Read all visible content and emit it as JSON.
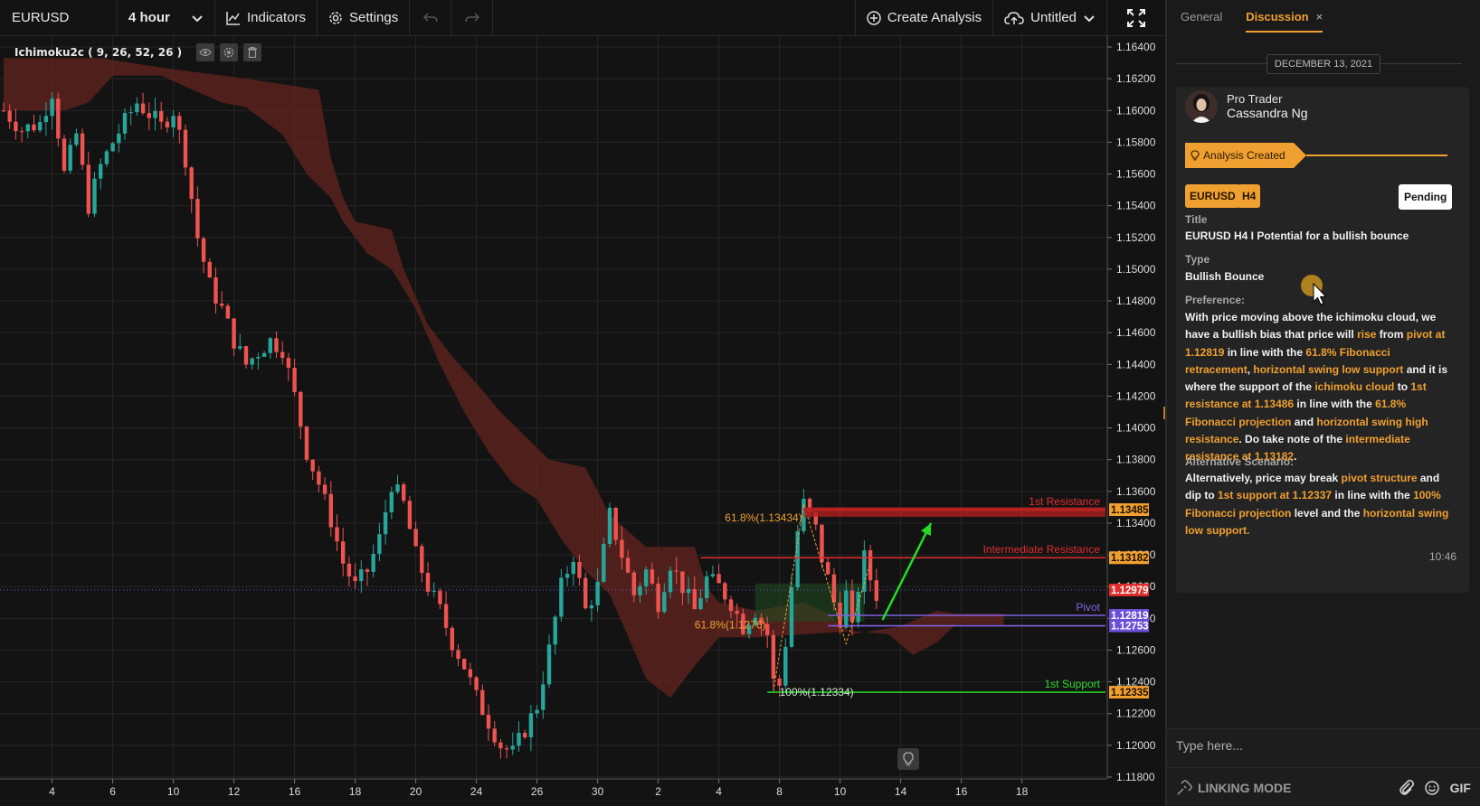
{
  "toolbar": {
    "symbol": "EURUSD",
    "interval": "4 hour",
    "indicators_label": "Indicators",
    "settings_label": "Settings",
    "create_analysis_label": "Create Analysis",
    "layout_name": "Untitled"
  },
  "indicator_legend": {
    "name": "Ichimoku2c ( 9, 26, 52, 26 )"
  },
  "chart_data": {
    "type": "candlestick",
    "symbol": "EURUSD",
    "interval": "4 hour",
    "y_ticks": [
      "1.16400",
      "1.16200",
      "1.16000",
      "1.15800",
      "1.15600",
      "1.15400",
      "1.15200",
      "1.15000",
      "1.14800",
      "1.14600",
      "1.14400",
      "1.14200",
      "1.14000",
      "1.13800",
      "1.13600",
      "1.13400",
      "1.13200",
      "1.13000",
      "1.12800",
      "1.12600",
      "1.12400",
      "1.12200",
      "1.12000",
      "1.11800"
    ],
    "y_tick_values": [
      1.164,
      1.162,
      1.16,
      1.158,
      1.156,
      1.154,
      1.152,
      1.15,
      1.148,
      1.146,
      1.144,
      1.142,
      1.14,
      1.138,
      1.136,
      1.134,
      1.132,
      1.13,
      1.128,
      1.126,
      1.124,
      1.122,
      1.12,
      1.118
    ],
    "ylim": [
      1.118,
      1.164
    ],
    "x_ticks": [
      "4",
      "6",
      "10",
      "12",
      "16",
      "18",
      "20",
      "24",
      "26",
      "30",
      "2",
      "4",
      "8",
      "10",
      "14",
      "16",
      "18"
    ],
    "x_tick_index": [
      8,
      18,
      28,
      38,
      48,
      58,
      68,
      78,
      88,
      98,
      108,
      118,
      128,
      138,
      148,
      158,
      168
    ],
    "close_path": [
      [
        0,
        1.16
      ],
      [
        3,
        1.1588
      ],
      [
        6,
        1.1592
      ],
      [
        8,
        1.1612
      ],
      [
        10,
        1.156
      ],
      [
        12,
        1.1585
      ],
      [
        14,
        1.154
      ],
      [
        16,
        1.1565
      ],
      [
        18,
        1.158
      ],
      [
        20,
        1.1593
      ],
      [
        22,
        1.1605
      ],
      [
        24,
        1.1598
      ],
      [
        26,
        1.159
      ],
      [
        28,
        1.16
      ],
      [
        30,
        1.157
      ],
      [
        32,
        1.152
      ],
      [
        34,
        1.149
      ],
      [
        36,
        1.1475
      ],
      [
        38,
        1.1455
      ],
      [
        40,
        1.144
      ],
      [
        42,
        1.1448
      ],
      [
        44,
        1.1455
      ],
      [
        46,
        1.145
      ],
      [
        48,
        1.142
      ],
      [
        50,
        1.1385
      ],
      [
        52,
        1.1365
      ],
      [
        54,
        1.1342
      ],
      [
        56,
        1.1315
      ],
      [
        58,
        1.13
      ],
      [
        60,
        1.131
      ],
      [
        62,
        1.133
      ],
      [
        64,
        1.1365
      ],
      [
        66,
        1.1352
      ],
      [
        68,
        1.132
      ],
      [
        70,
        1.13
      ],
      [
        72,
        1.1285
      ],
      [
        74,
        1.1265
      ],
      [
        76,
        1.125
      ],
      [
        78,
        1.123
      ],
      [
        80,
        1.1215
      ],
      [
        82,
        1.12
      ],
      [
        84,
        1.1195
      ],
      [
        86,
        1.121
      ],
      [
        88,
        1.1225
      ],
      [
        90,
        1.126
      ],
      [
        92,
        1.13
      ],
      [
        94,
        1.132
      ],
      [
        96,
        1.1285
      ],
      [
        98,
        1.13
      ],
      [
        100,
        1.1345
      ],
      [
        102,
        1.132
      ],
      [
        104,
        1.1295
      ],
      [
        106,
        1.131
      ],
      [
        108,
        1.129
      ],
      [
        110,
        1.1315
      ],
      [
        112,
        1.13
      ],
      [
        114,
        1.1285
      ],
      [
        116,
        1.1305
      ],
      [
        118,
        1.13
      ],
      [
        120,
        1.129
      ],
      [
        122,
        1.1275
      ],
      [
        124,
        1.1285
      ],
      [
        126,
        1.127
      ],
      [
        127,
        1.124
      ],
      [
        128,
        1.1238
      ],
      [
        129,
        1.1265
      ],
      [
        130,
        1.13
      ],
      [
        131,
        1.1335
      ],
      [
        132,
        1.1352
      ],
      [
        133,
        1.1344
      ],
      [
        134,
        1.1336
      ],
      [
        135,
        1.1318
      ],
      [
        136,
        1.1305
      ],
      [
        137,
        1.129
      ],
      [
        138,
        1.128
      ],
      [
        139,
        1.1295
      ],
      [
        140,
        1.1272
      ],
      [
        141,
        1.13
      ],
      [
        142,
        1.1318
      ],
      [
        143,
        1.1305
      ],
      [
        144,
        1.1295
      ]
    ],
    "cloud_upper": [
      [
        0,
        1.1633
      ],
      [
        16,
        1.1633
      ],
      [
        26,
        1.1627
      ],
      [
        40,
        1.162
      ],
      [
        52,
        1.1613
      ],
      [
        54,
        1.157
      ],
      [
        56,
        1.1545
      ],
      [
        58,
        1.153
      ],
      [
        64,
        1.1525
      ],
      [
        66,
        1.15
      ],
      [
        70,
        1.1465
      ],
      [
        74,
        1.1445
      ],
      [
        78,
        1.1428
      ],
      [
        82,
        1.141
      ],
      [
        86,
        1.1395
      ],
      [
        90,
        1.138
      ],
      [
        96,
        1.1375
      ],
      [
        100,
        1.1345
      ],
      [
        106,
        1.1325
      ],
      [
        110,
        1.1325
      ],
      [
        114,
        1.1325
      ],
      [
        116,
        1.13
      ],
      [
        118,
        1.129
      ],
      [
        124,
        1.1285
      ],
      [
        132,
        1.129
      ],
      [
        136,
        1.1283
      ],
      [
        140,
        1.127
      ],
      [
        148,
        1.1275
      ],
      [
        154,
        1.1285
      ],
      [
        157,
        1.1283
      ],
      [
        165,
        1.1283
      ]
    ],
    "cloud_lower": [
      [
        165,
        1.1276
      ],
      [
        157,
        1.1276
      ],
      [
        154,
        1.1265
      ],
      [
        150,
        1.1257
      ],
      [
        146,
        1.127
      ],
      [
        140,
        1.1272
      ],
      [
        132,
        1.127
      ],
      [
        124,
        1.1268
      ],
      [
        118,
        1.1268
      ],
      [
        114,
        1.125
      ],
      [
        110,
        1.123
      ],
      [
        106,
        1.1242
      ],
      [
        104,
        1.126
      ],
      [
        100,
        1.1295
      ],
      [
        96,
        1.131
      ],
      [
        92,
        1.133
      ],
      [
        88,
        1.1355
      ],
      [
        84,
        1.1365
      ],
      [
        80,
        1.1385
      ],
      [
        76,
        1.141
      ],
      [
        72,
        1.144
      ],
      [
        68,
        1.1475
      ],
      [
        64,
        1.15
      ],
      [
        60,
        1.151
      ],
      [
        56,
        1.153
      ],
      [
        54,
        1.1545
      ],
      [
        50,
        1.156
      ],
      [
        46,
        1.1585
      ],
      [
        40,
        1.1602
      ],
      [
        36,
        1.1605
      ],
      [
        30,
        1.1615
      ],
      [
        26,
        1.1622
      ],
      [
        18,
        1.1622
      ],
      [
        14,
        1.1605
      ],
      [
        10,
        1.16
      ],
      [
        0,
        1.16
      ]
    ],
    "levels": [
      {
        "name": "1st Resistance",
        "value": 1.13485,
        "price_label": "1.13485",
        "color": "#e02d2d",
        "badge_color": "#f0a030",
        "start_index": 132
      },
      {
        "name": "Intermediate Resistance",
        "value": 1.13182,
        "price_label": "1.13182",
        "color": "#e02d2d",
        "badge_color": "#f0a030",
        "start_index": 115
      },
      {
        "name": "Pivot",
        "value": 1.12819,
        "price_label": "1.12819",
        "color": "#8060e0",
        "badge_color": "#6a4fd8",
        "start_index": 136
      },
      {
        "name": "",
        "value": 1.12753,
        "price_label": "1.12753",
        "color": "#8060e0",
        "badge_color": "#6a4fd8",
        "start_index": 136
      },
      {
        "name": "1st Support",
        "value": 1.12335,
        "price_label": "1.12335",
        "color": "#22cc22",
        "badge_color": "#f0a030",
        "start_index": 126
      }
    ],
    "current_price": {
      "value": 1.12979,
      "price_label": "1.12979",
      "color": "#e02d2d"
    },
    "fib_labels": [
      {
        "text": "61.8%(1.13434)",
        "value": 1.13434,
        "index": 119,
        "color": "#f0a030"
      },
      {
        "text": "61.8%(1.1276)",
        "value": 1.1276,
        "index": 114,
        "color": "#f0a030"
      },
      {
        "text": "100%(1.12334)",
        "value": 1.12334,
        "index": 128,
        "color": "#cfe8cf"
      }
    ],
    "projection_arrow": {
      "from": [
        145,
        1.1279
      ],
      "to": [
        153,
        1.134
      ],
      "color": "#22dd22"
    },
    "colors": {
      "bull": "#26a69a",
      "bear": "#ef5350",
      "cloud": "#5a231d",
      "green_cloud": "#1f4d1f",
      "grid": "#262626"
    }
  },
  "panel": {
    "tabs": [
      {
        "label": "General"
      },
      {
        "label": "Discussion",
        "close": "×"
      }
    ],
    "date": "DECEMBER 13, 2021",
    "author_role": "Pro Trader",
    "author_name": "Cassandra Ng",
    "event_label": "Analysis Created",
    "tags": [
      "EURUSD",
      "H4"
    ],
    "status": "Pending",
    "title_label": "Title",
    "title_value": "EURUSD H4 I Potential for a bullish bounce",
    "type_label": "Type",
    "type_value": "Bullish Bounce",
    "preference_label": "Preference:",
    "preference": {
      "t1": "With price moving above the ichimoku cloud, we have a bullish bias that price will ",
      "h1": "rise",
      "t2": " from ",
      "h2": "pivot at 1.12819",
      "t3": " in line with the ",
      "h3": "61.8% Fibonacci retracement",
      "t4": ", ",
      "h4": "horizontal swing low support",
      "t5": " and it is where the support of the ",
      "h5": "ichimoku cloud",
      "t6": " to ",
      "h6": "1st resistance at 1.13486",
      "t7": " in line with the ",
      "h7": "61.8% Fibonacci projection",
      "t8": " and ",
      "h8": "horizontal swing high resistance",
      "t9": ". Do take note of the ",
      "h9": "intermediate resistance at 1.13182",
      "t10": "."
    },
    "alt_label": "Alternative Scenario:",
    "alternative": {
      "t1": "Alternatively, price may break ",
      "h1": "pivot structure",
      "t2": " and dip to ",
      "h2": "1st support at 1.12337",
      "t3": " in line with the ",
      "h3": "100% Fibonacci projection",
      "t4": " level and the ",
      "h4": "horizontal swing low support.",
      "t5": ""
    },
    "time": "10:46"
  },
  "composer": {
    "placeholder": "Type here...",
    "linking_mode": "LINKING MODE",
    "gif_label": "GIF"
  }
}
